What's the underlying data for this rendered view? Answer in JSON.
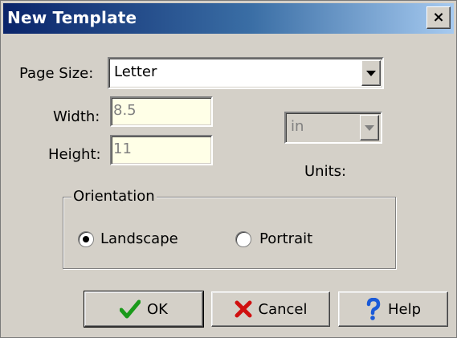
{
  "window": {
    "title": "New Template",
    "close_glyph": "×"
  },
  "page_size": {
    "label": "Page Size:",
    "value": "Letter"
  },
  "width": {
    "label": "Width:",
    "value": "8.5"
  },
  "height": {
    "label": "Height:",
    "value": "11"
  },
  "units": {
    "label": "Units:",
    "value": "in"
  },
  "orientation": {
    "label": "Orientation",
    "landscape": {
      "label": "Landscape",
      "selected": true
    },
    "portrait": {
      "label": "Portrait",
      "selected": false
    }
  },
  "buttons": {
    "ok": {
      "label": "OK",
      "icon": "checkmark-icon",
      "color": "#1a9a1a"
    },
    "cancel": {
      "label": "Cancel",
      "icon": "x-icon",
      "color": "#d01010"
    },
    "help": {
      "label": "Help",
      "icon": "question-icon",
      "color": "#1a5ad8"
    }
  }
}
